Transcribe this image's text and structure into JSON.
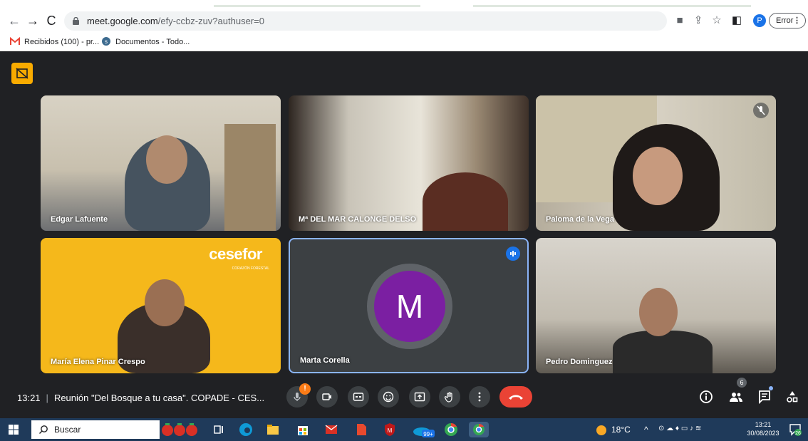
{
  "browser": {
    "url_host": "meet.google.com",
    "url_path": "/efy-ccbz-zuv?authuser=0",
    "profile_initial": "P",
    "error_label": "Error",
    "bookmarks": [
      {
        "label": "Recibidos (100) - pr...",
        "icon": "gmail-icon"
      },
      {
        "label": "Documentos - Todo...",
        "icon": "docs-icon"
      }
    ]
  },
  "meeting": {
    "time": "13:21",
    "title": "Reunión \"Del Bosque a tu casa\". COPADE - CES...",
    "people_count": "6",
    "participants": [
      {
        "name": "Edgar Lafuente"
      },
      {
        "name": "Mª DEL MAR CALONGE DELSO"
      },
      {
        "name": "Paloma de la Vega"
      },
      {
        "name": "María Elena Pinar Crespo"
      },
      {
        "name": "Marta Corella",
        "initial": "M"
      },
      {
        "name": "Pedro Dominguez"
      }
    ],
    "logo_text_a": "cese",
    "logo_text_b": "for",
    "logo_tagline": "CORAZÓN FORESTAL",
    "mic_badge": "!"
  },
  "taskbar": {
    "search_label": "Buscar",
    "temperature": "18°C",
    "time": "13:21",
    "date": "30/08/2023",
    "notification_count": "26",
    "app_badge": "99+"
  },
  "colors": {
    "meet_bg": "#202124",
    "hangup": "#ea4335",
    "avatar": "#7b1fa2",
    "badge": "#f9ab00",
    "speaking": "#1a73e8"
  }
}
